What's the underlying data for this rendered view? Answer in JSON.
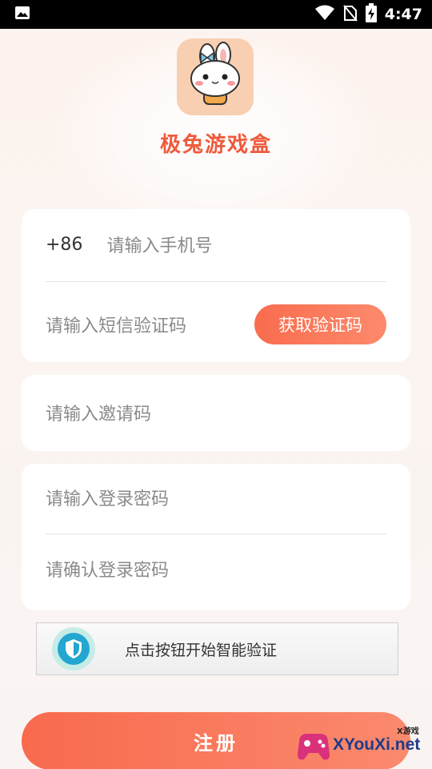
{
  "status_bar": {
    "time": "4:47",
    "icons": [
      "image-icon",
      "wifi-icon",
      "no-sim-icon",
      "battery-charging-icon"
    ]
  },
  "header": {
    "logo": "rabbit-mascot-logo",
    "app_name": "极兔游戏盒"
  },
  "form": {
    "country_code": "+86",
    "phone_placeholder": "请输入手机号",
    "sms_code_placeholder": "请输入短信验证码",
    "get_code_label": "获取验证码",
    "invite_code_placeholder": "请输入邀请码",
    "password_placeholder": "请输入登录密码",
    "confirm_password_placeholder": "请确认登录密码"
  },
  "captcha": {
    "label": "点击按钮开始智能验证"
  },
  "submit_label": "注册",
  "watermark": {
    "text": "XYouXi.net",
    "small": "X游戏"
  },
  "colors": {
    "accent": "#f86a4e",
    "title": "#f05a3c",
    "placeholder": "#8a8a8a",
    "shield": "#23a6cf"
  }
}
